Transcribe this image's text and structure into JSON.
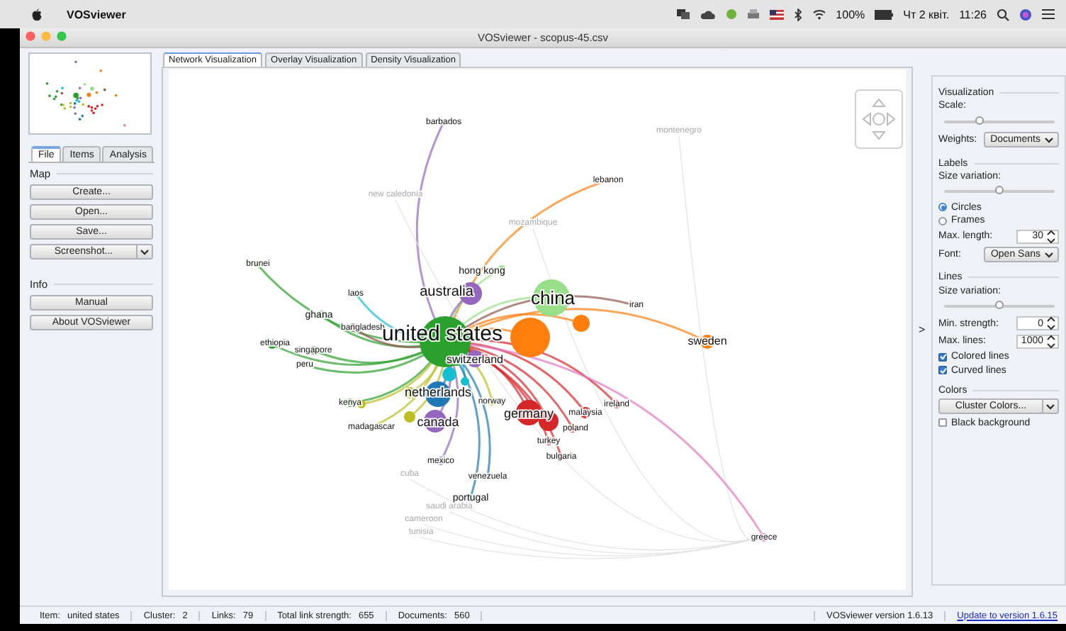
{
  "menu_bar": {
    "app_name": "VOSviewer",
    "battery": "100%",
    "date": "Чт 2 квіт.",
    "time": "11:26"
  },
  "window": {
    "title": "VOSviewer - scopus-45.csv"
  },
  "left_panel": {
    "tabs": [
      {
        "label": "File",
        "selected": true
      },
      {
        "label": "Items",
        "selected": false
      },
      {
        "label": "Analysis",
        "selected": false
      }
    ],
    "sections": [
      {
        "title": "Map",
        "buttons": [
          {
            "label": "Create...",
            "dropdown": false
          },
          {
            "label": "Open...",
            "dropdown": false
          },
          {
            "label": "Save...",
            "dropdown": false
          },
          {
            "label": "Screenshot...",
            "dropdown": true
          }
        ]
      },
      {
        "title": "Info",
        "buttons": [
          {
            "label": "Manual",
            "dropdown": false
          },
          {
            "label": "About VOSviewer",
            "dropdown": false
          }
        ]
      }
    ]
  },
  "view_tabs": [
    {
      "label": "Network Visualization",
      "selected": true
    },
    {
      "label": "Overlay Visualization",
      "selected": false
    },
    {
      "label": "Density Visualization",
      "selected": false
    }
  ],
  "network": {
    "nodes": [
      {
        "kind": "labeled",
        "label": "barbados",
        "color": "#9467bd"
      },
      {
        "kind": "faint",
        "label": "montenegro"
      },
      {
        "kind": "labeled",
        "label": "lebanon",
        "color": "#ff7f0e"
      },
      {
        "kind": "faint",
        "label": "new caledonia"
      },
      {
        "kind": "faint",
        "label": "mozambique"
      },
      {
        "kind": "labeled",
        "label": "brunei",
        "color": "#2ca02c"
      },
      {
        "kind": "labeled",
        "label": "hong kong",
        "color": "#98df8a"
      },
      {
        "kind": "labeled",
        "label": "laos",
        "color": "#17becf"
      },
      {
        "kind": "labeled",
        "label": "australia",
        "color": "#9467bd"
      },
      {
        "kind": "labeled",
        "label": "china",
        "color": "#98df8a"
      },
      {
        "kind": "labeled",
        "label": "iran",
        "color": "#8c564b"
      },
      {
        "kind": "labeled",
        "label": "ghana",
        "color": "#2ca02c"
      },
      {
        "kind": "unlabeled",
        "color": "#ff7f0e"
      },
      {
        "kind": "labeled",
        "label": "bangladesh",
        "color": "#8c564b"
      },
      {
        "kind": "labeled",
        "label": "ethiopia",
        "color": "#2ca02c"
      },
      {
        "kind": "labeled",
        "label": "singapore",
        "color": "#2ca02c"
      },
      {
        "kind": "labeled",
        "label": "united states",
        "color": "#2ca02c"
      },
      {
        "kind": "unlabeled",
        "color": "#ff7f0e"
      },
      {
        "kind": "labeled",
        "label": "sweden",
        "color": "#ff7f0e"
      },
      {
        "kind": "labeled",
        "label": "peru",
        "color": "#2ca02c"
      },
      {
        "kind": "unlabeled",
        "color": "#2ca02c"
      },
      {
        "kind": "labeled",
        "label": "switzerland",
        "color": "#9467bd"
      },
      {
        "kind": "unlabeled",
        "color": "#17becf"
      },
      {
        "kind": "unlabeled",
        "color": "#17becf"
      },
      {
        "kind": "labeled",
        "label": "kenya",
        "color": "#2ca02c"
      },
      {
        "kind": "unlabeled",
        "color": "#bcbd22"
      },
      {
        "kind": "unlabeled",
        "color": "#bcbd22"
      },
      {
        "kind": "labeled",
        "label": "netherlands",
        "color": "#1f77b4"
      },
      {
        "kind": "labeled",
        "label": "norway",
        "color": "#bcbd22"
      },
      {
        "kind": "labeled",
        "label": "ireland",
        "color": "#d62728"
      },
      {
        "kind": "labeled",
        "label": "madagascar",
        "color": "#bcbd22"
      },
      {
        "kind": "unlabeled",
        "color": "#bcbd22"
      },
      {
        "kind": "labeled",
        "label": "canada",
        "color": "#9467bd"
      },
      {
        "kind": "labeled",
        "label": "germany",
        "color": "#d62728"
      },
      {
        "kind": "unlabeled",
        "color": "#d62728"
      },
      {
        "kind": "labeled",
        "label": "malaysia",
        "color": "#d62728"
      },
      {
        "kind": "labeled",
        "label": "poland",
        "color": "#d62728"
      },
      {
        "kind": "labeled",
        "label": "turkey",
        "color": "#d62728"
      },
      {
        "kind": "labeled",
        "label": "mexico",
        "color": "#9467bd"
      },
      {
        "kind": "labeled",
        "label": "bulgaria",
        "color": "#d62728"
      },
      {
        "kind": "faint",
        "label": "cuba"
      },
      {
        "kind": "labeled",
        "label": "venezuela",
        "color": "#1f77b4"
      },
      {
        "kind": "labeled",
        "label": "portugal",
        "color": "#1f77b4"
      },
      {
        "kind": "faint",
        "label": "saudi arabia"
      },
      {
        "kind": "faint",
        "label": "cameroon"
      },
      {
        "kind": "faint",
        "label": "tunisia"
      },
      {
        "kind": "labeled",
        "label": "greece",
        "color": "#e377c2"
      }
    ]
  },
  "panel_toggle": ">",
  "options_panel": {
    "sections": [
      {
        "title": "Visualization",
        "controls": [
          {
            "kind": "label",
            "text": "Scale:"
          },
          {
            "kind": "slider",
            "level": 0.32
          },
          {
            "kind": "select",
            "label": "Weights:",
            "value": "Documents"
          }
        ]
      },
      {
        "title": "Labels",
        "controls": [
          {
            "kind": "label",
            "text": "Size variation:"
          },
          {
            "kind": "slider",
            "level": 0.5
          },
          {
            "kind": "radio",
            "label": "Circles",
            "selected": true
          },
          {
            "kind": "radio",
            "label": "Frames",
            "selected": false
          },
          {
            "kind": "spinner",
            "label": "Max. length:",
            "value": "30"
          },
          {
            "kind": "select",
            "label": "Font:",
            "value": "Open Sans"
          }
        ]
      },
      {
        "title": "Lines",
        "controls": [
          {
            "kind": "label",
            "text": "Size variation:"
          },
          {
            "kind": "slider",
            "level": 0.5
          },
          {
            "kind": "spinner",
            "label": "Min. strength:",
            "value": "0"
          },
          {
            "kind": "spinner",
            "label": "Max. lines:",
            "value": "1000"
          },
          {
            "kind": "checkbox",
            "label": "Colored lines",
            "checked": true
          },
          {
            "kind": "checkbox",
            "label": "Curved lines",
            "checked": true
          }
        ]
      },
      {
        "title": "Colors",
        "controls": [
          {
            "kind": "split-button",
            "label": "Cluster Colors..."
          },
          {
            "kind": "checkbox",
            "label": "Black background",
            "checked": false
          }
        ]
      }
    ]
  },
  "status_bar": {
    "fields": [
      {
        "label": "Item:",
        "value": "united states"
      },
      {
        "label": "Cluster:",
        "value": "2"
      },
      {
        "label": "Links:",
        "value": "79"
      },
      {
        "label": "Total link strength:",
        "value": "655"
      },
      {
        "label": "Documents:",
        "value": "560"
      }
    ],
    "version": "VOSviewer version 1.6.13",
    "update_link": "Update to version 1.6.15"
  }
}
